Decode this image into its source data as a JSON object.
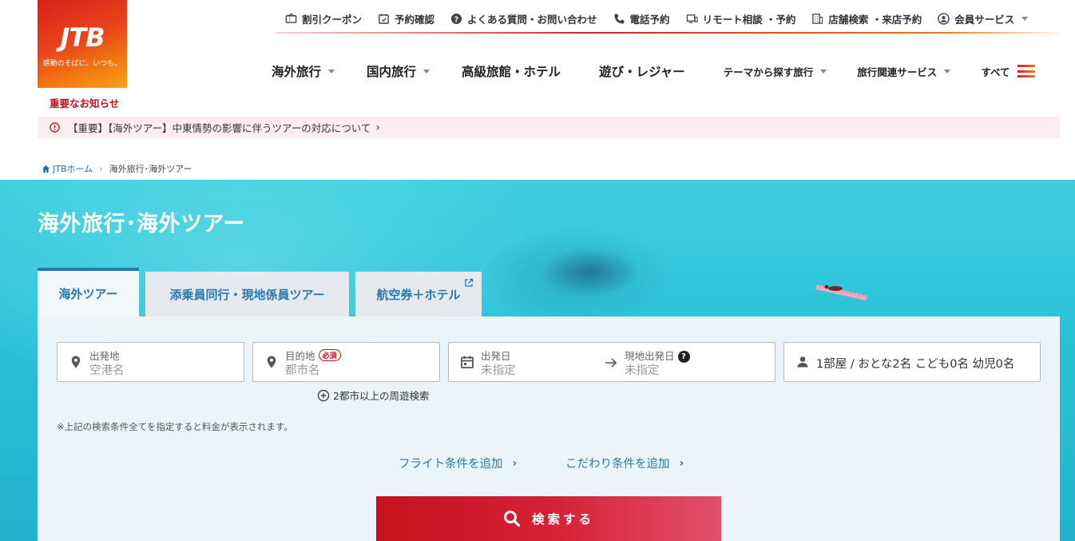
{
  "brand": {
    "logo_text": "JTB",
    "tagline": "感動のそばに、いつも。"
  },
  "utility_nav": [
    {
      "icon": "coupon-icon",
      "label": "割引クーポン"
    },
    {
      "icon": "calendar-check-icon",
      "label": "予約確認"
    },
    {
      "icon": "question-icon",
      "label": "よくある質問・お問い合わせ"
    },
    {
      "icon": "phone-icon",
      "label": "電話予約"
    },
    {
      "icon": "monitor-icon",
      "label": "リモート相談 ・予約"
    },
    {
      "icon": "building-icon",
      "label": "店舗検索 ・来店予約"
    },
    {
      "icon": "user-circle-icon",
      "label": "会員サービス"
    }
  ],
  "main_nav": [
    {
      "label": "海外旅行",
      "dropdown": true
    },
    {
      "label": "国内旅行",
      "dropdown": true
    },
    {
      "label": "高級旅館・ホテル",
      "dropdown": false
    },
    {
      "label": "遊び・レジャー",
      "dropdown": false
    },
    {
      "label": "テーマから探す旅行",
      "dropdown": true
    },
    {
      "label": "旅行関連サービス",
      "dropdown": true
    },
    {
      "label": "すべて",
      "dropdown": false
    }
  ],
  "notice": {
    "title": "重要なお知らせ",
    "text": "【重要】【海外ツアー】中東情勢の影響に伴うツアーの対応について"
  },
  "breadcrumb": {
    "home": "JTBホーム",
    "current": "海外旅行･海外ツアー"
  },
  "hero": {
    "title": "海外旅行･海外ツアー"
  },
  "tabs": [
    {
      "label": "海外ツアー",
      "active": true
    },
    {
      "label": "添乗員同行・現地係員ツアー",
      "active": false
    },
    {
      "label": "航空券＋ホテル",
      "active": false,
      "external": true
    }
  ],
  "search": {
    "origin": {
      "label": "出発地",
      "placeholder": "空港名"
    },
    "destination": {
      "label": "目的地",
      "required": "必須",
      "placeholder": "都市名"
    },
    "depart": {
      "label": "出発日",
      "placeholder": "未指定"
    },
    "local_depart": {
      "label": "現地出発日",
      "placeholder": "未指定"
    },
    "pax": {
      "room": "1部屋",
      "sep": "/",
      "adults": "おとな2名",
      "children": "こども0名",
      "infants": "幼児0名"
    },
    "multi_city": "2都市以上の周遊検索",
    "note": "※上記の検索条件全てを指定すると料金が表示されます。",
    "add_flight": "フライト条件を追加",
    "add_pref": "こだわり条件を追加",
    "button": "検索する"
  },
  "colors": {
    "brand_red": "#c3121c",
    "link_blue": "#2479b3",
    "sea": "#28bfd6"
  }
}
